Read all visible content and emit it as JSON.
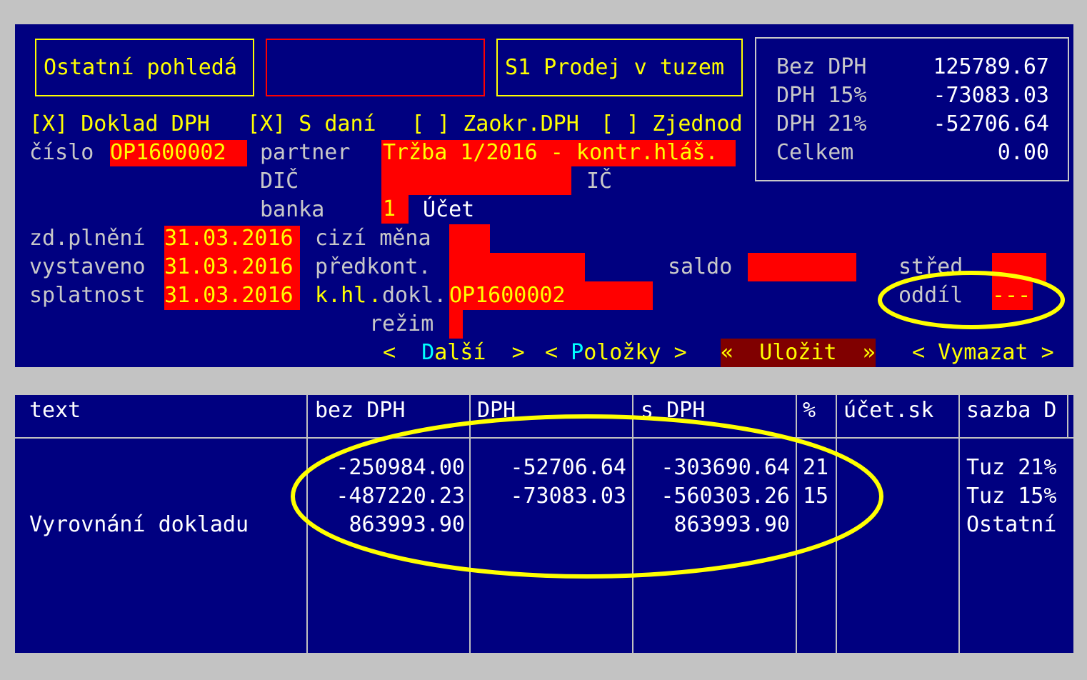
{
  "header_boxes": {
    "doc_type": "Ostatní pohledá",
    "blank": "",
    "vat_type": "S1 Prodej v tuzem"
  },
  "summary": {
    "rows": [
      {
        "label": "Bez DPH",
        "value": "125789.67"
      },
      {
        "label": "DPH 15%",
        "value": "-73083.03"
      },
      {
        "label": "DPH 21%",
        "value": "-52706.64"
      },
      {
        "label": "Celkem",
        "value": "0.00"
      }
    ]
  },
  "checkboxes": {
    "doklad_dph": "[X] Doklad DPH",
    "s_dani": "[X] S daní",
    "zaokr_dph": "[ ] Zaokr.DPH",
    "zjednod": "[ ] Zjednod"
  },
  "form": {
    "cislo_label": "číslo",
    "cislo_value": "OP1600002",
    "partner_label": "partner",
    "partner_value": "Tržba 1/2016 - kontr.hláš.",
    "dic_label": "DIČ",
    "dic_value": "",
    "ic_label": "IČ",
    "banka_label": "banka",
    "banka_value": "1",
    "ucet_label": "Účet",
    "zd_plneni_label": "zd.plnění",
    "zd_plneni_value": "31.03.2016",
    "cizi_mena_label": "cizí měna",
    "cizi_mena_value": "",
    "vystaveno_label": "vystaveno",
    "vystaveno_value": "31.03.2016",
    "predkont_label": "předkont.",
    "predkont_value": "",
    "saldo_label": "saldo",
    "saldo_value": "",
    "stred_label": "střed",
    "stred_value": "",
    "splatnost_label": "splatnost",
    "splatnost_value": "31.03.2016",
    "khl_label_a": "k.hl",
    "khl_label_b": ".",
    "khl_label_c": "dokl.",
    "khl_value": "OP1600002",
    "oddil_label": "oddíl",
    "oddil_value": "---",
    "rezim_label": "režim",
    "rezim_value": ""
  },
  "buttons": {
    "dalsi": {
      "open": "<  ",
      "hot": "D",
      "rest": "alší",
      "close": "  >"
    },
    "polozky": {
      "open": "< ",
      "hot": "P",
      "rest": "oložky",
      "close": " >"
    },
    "ulozit": {
      "open": "«  ",
      "text": "Uložit",
      "close": "  »"
    },
    "vymazat": {
      "open": "< ",
      "text": "Vymazat",
      "close": " >"
    }
  },
  "grid": {
    "columns": [
      "text",
      "bez DPH",
      "DPH",
      "s DPH",
      "%",
      "účet.sk",
      "sazba D"
    ],
    "rows": [
      {
        "text": "",
        "bez_dph": "-250984.00",
        "dph": "-52706.64",
        "s_dph": "-303690.64",
        "pct": "21",
        "ucet_sk": "",
        "sazba": "Tuz 21%"
      },
      {
        "text": "",
        "bez_dph": "-487220.23",
        "dph": "-73083.03",
        "s_dph": "-560303.26",
        "pct": "15",
        "ucet_sk": "",
        "sazba": "Tuz 15%"
      },
      {
        "text": "Vyrovnání dokladu",
        "bez_dph": "863993.90",
        "dph": "",
        "s_dph": "863993.90",
        "pct": "",
        "ucet_sk": "",
        "sazba": "Ostatní"
      }
    ]
  },
  "colors": {
    "background": "#000080",
    "field": "#ff0000",
    "label": "#c8c8c8",
    "value": "#ffff00",
    "hotkey": "#00ffff",
    "save_button": "#800000",
    "annotation": "#ffff00"
  }
}
